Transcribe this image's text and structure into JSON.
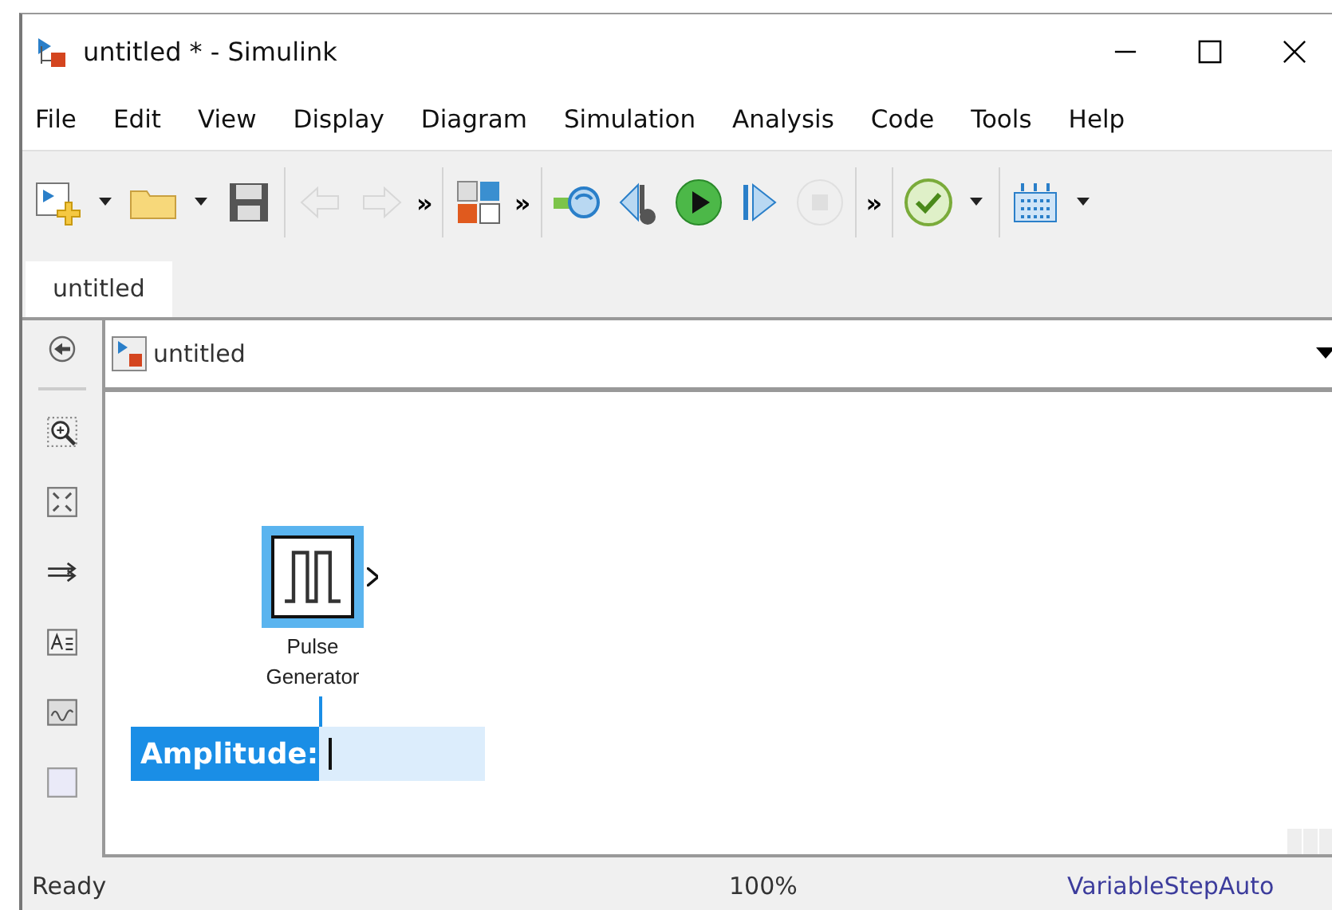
{
  "window": {
    "title": "untitled * - Simulink"
  },
  "menu": [
    "File",
    "Edit",
    "View",
    "Display",
    "Diagram",
    "Simulation",
    "Analysis",
    "Code",
    "Tools",
    "Help"
  ],
  "toolbar": [
    {
      "kind": "button",
      "disabled": false
    },
    {
      "kind": "caret"
    },
    {
      "kind": "button",
      "disabled": false
    },
    {
      "kind": "caret"
    },
    {
      "kind": "button",
      "disabled": false
    },
    {
      "kind": "separator"
    },
    {
      "kind": "button",
      "disabled": true
    },
    {
      "kind": "button",
      "disabled": true
    },
    {
      "kind": "overflow",
      "label": "»"
    },
    {
      "kind": "separator"
    },
    {
      "kind": "button",
      "disabled": false
    },
    {
      "kind": "overflow",
      "label": "»"
    },
    {
      "kind": "separator"
    },
    {
      "kind": "button",
      "disabled": false
    },
    {
      "kind": "button",
      "disabled": false
    },
    {
      "kind": "button",
      "disabled": false
    },
    {
      "kind": "button",
      "disabled": false
    },
    {
      "kind": "button",
      "disabled": true
    },
    {
      "kind": "separator"
    },
    {
      "kind": "overflow",
      "label": "»"
    },
    {
      "kind": "separator"
    },
    {
      "kind": "button",
      "disabled": false
    },
    {
      "kind": "caret"
    },
    {
      "kind": "separator"
    },
    {
      "kind": "button",
      "disabled": false
    },
    {
      "kind": "caret"
    }
  ],
  "tabs": [
    {
      "label": "untitled",
      "selected": true
    }
  ],
  "address": {
    "path": "untitled"
  },
  "block": {
    "name": "Pulse Generator",
    "selected": true
  },
  "parameter_editor": {
    "label": "Amplitude:"
  },
  "status_bar": {
    "state": "Ready",
    "zoom": "100%",
    "solver": "VariableStepAuto"
  }
}
